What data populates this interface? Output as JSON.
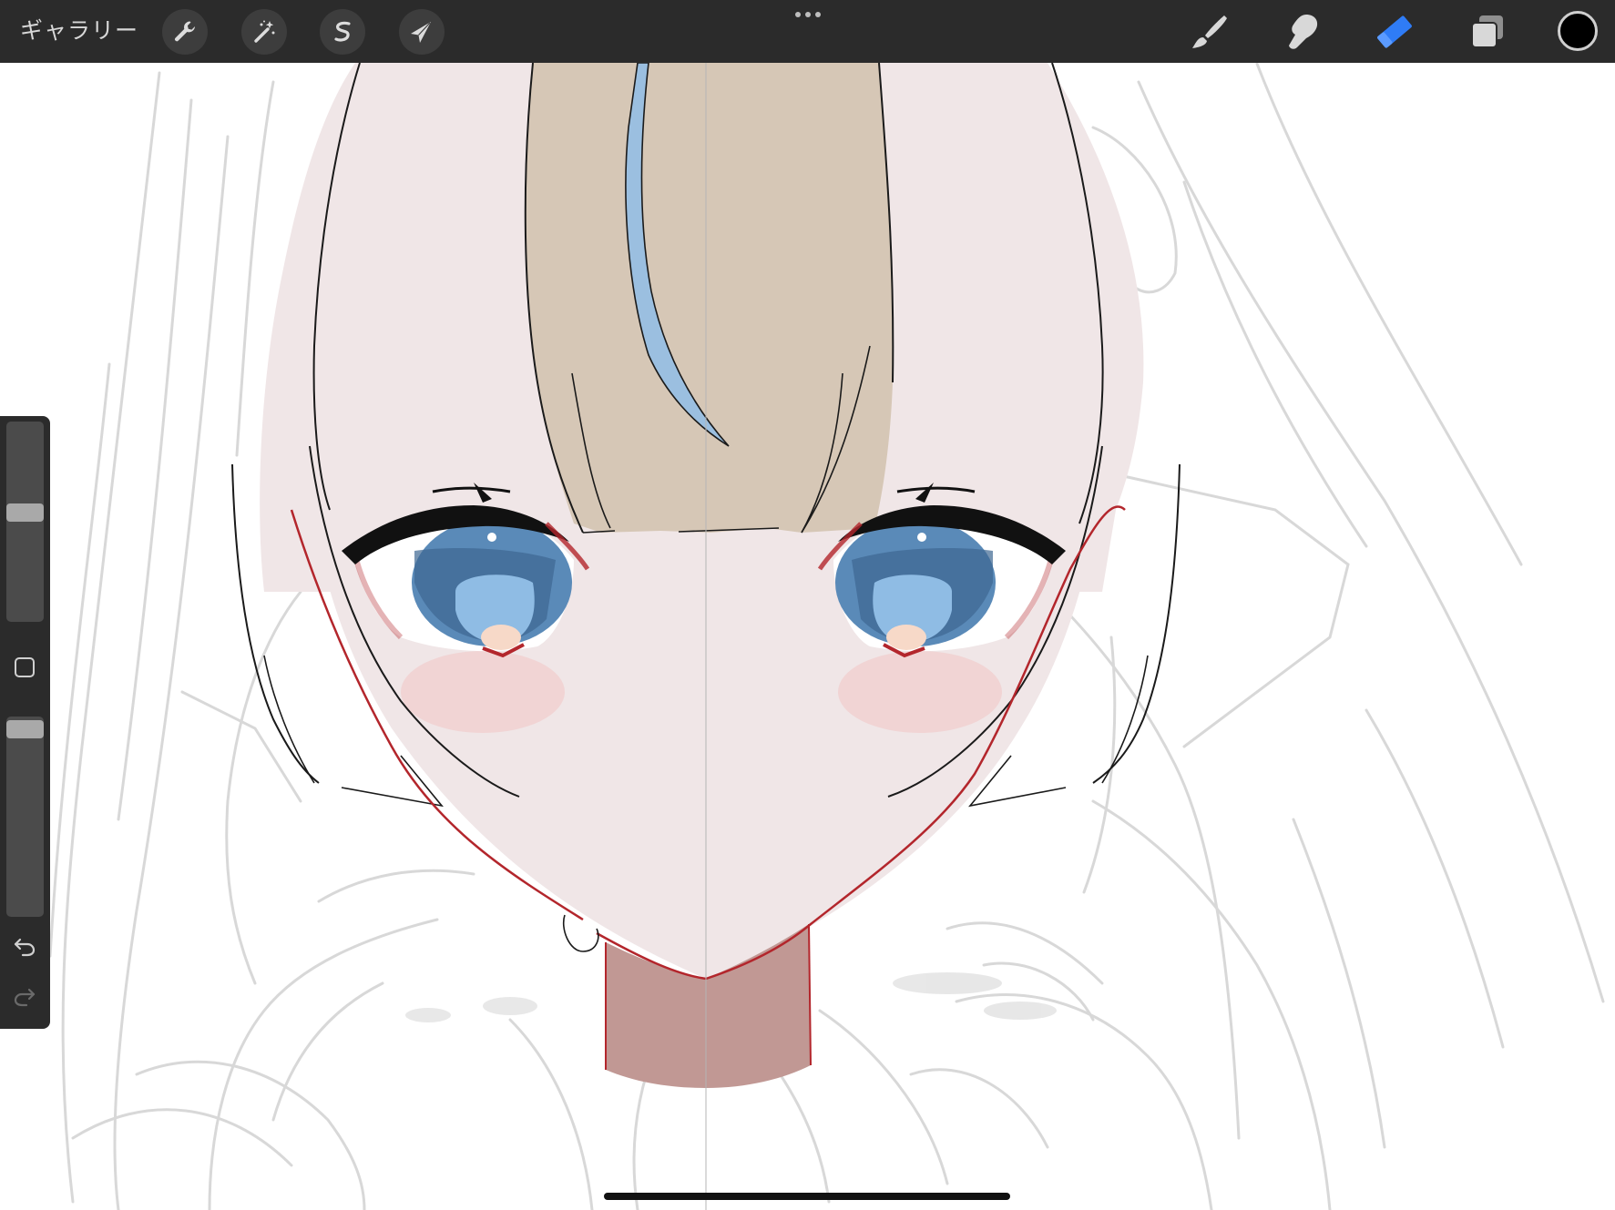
{
  "toolbar": {
    "gallery_label": "ギャラリー",
    "left_tools": [
      {
        "name": "actions",
        "icon": "wrench-icon"
      },
      {
        "name": "adjustments",
        "icon": "magic-wand-icon"
      },
      {
        "name": "selection",
        "icon": "selection-s-icon"
      },
      {
        "name": "transform",
        "icon": "arrow-cursor-icon"
      }
    ],
    "more_icon": "ellipsis-icon",
    "right_tools": [
      {
        "name": "paint",
        "icon": "brush-icon",
        "active": false
      },
      {
        "name": "smudge",
        "icon": "smudge-finger-icon",
        "active": false
      },
      {
        "name": "erase",
        "icon": "eraser-icon",
        "active": true
      },
      {
        "name": "layers",
        "icon": "layers-icon",
        "active": false
      }
    ],
    "current_color": "#000000",
    "active_tool_color": "#2f7cf6",
    "inactive_tool_color": "#d8d8d8"
  },
  "sidebar": {
    "brush_size": 0.55,
    "brush_opacity": 0.98,
    "modify_icon": "square-icon",
    "undo_icon": "undo-icon",
    "redo_icon": "redo-icon"
  },
  "canvas": {
    "colors": {
      "skin": "#f0e6e7",
      "hair": "#d6c7b6",
      "hair_streak": "#9bbfe0",
      "neck": "#c19894",
      "iris": "#5a8ab8",
      "pupil_light": "#8fbce4",
      "lash": "#111111",
      "outline_red": "#b3262c",
      "sketch": "#d8d8d8",
      "blush": "#f3c4c4"
    }
  }
}
